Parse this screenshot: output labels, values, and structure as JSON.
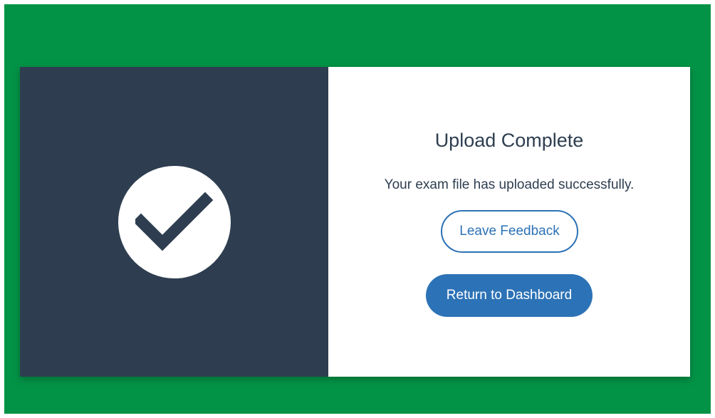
{
  "dialog": {
    "title": "Upload Complete",
    "message": "Your exam file has uploaded successfully.",
    "feedback_label": "Leave Feedback",
    "dashboard_label": "Return to Dashboard",
    "status_icon": "checkmark-icon"
  },
  "colors": {
    "page_background": "#039346",
    "panel_dark": "#2e3e50",
    "accent": "#2c72b6"
  }
}
